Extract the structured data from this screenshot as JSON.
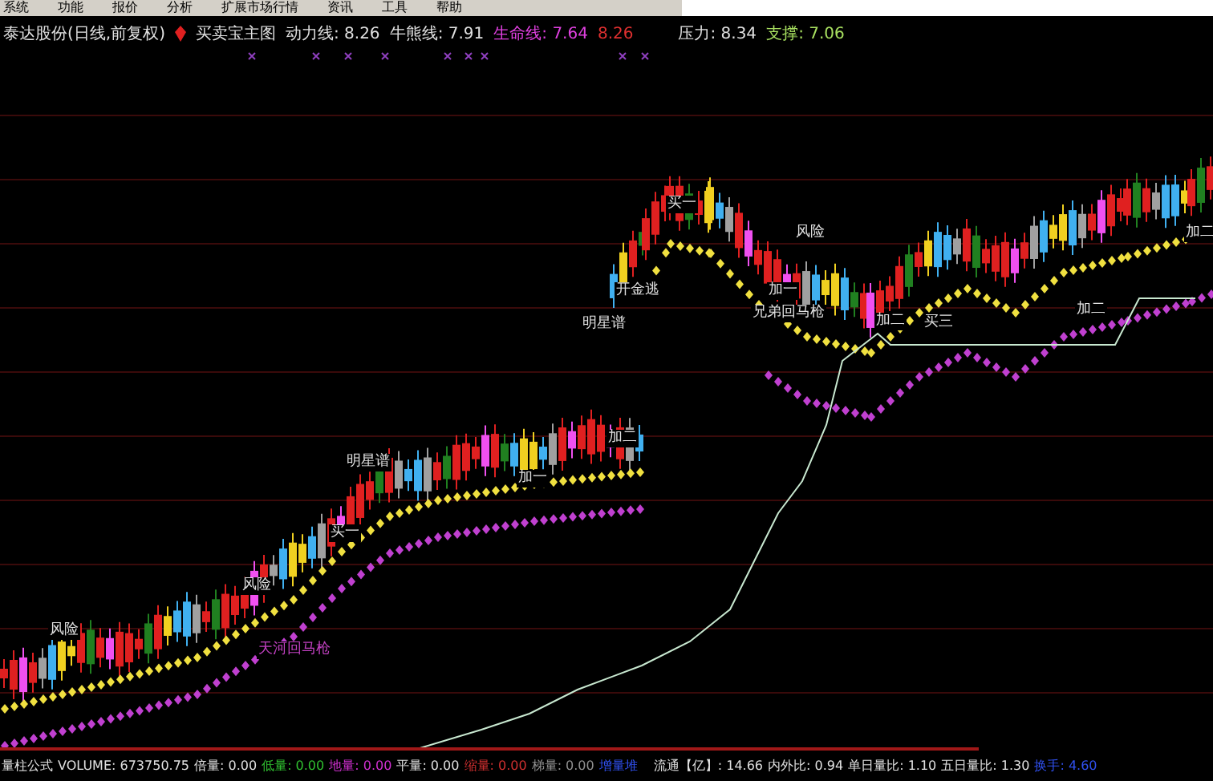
{
  "menu": [
    "系统",
    "功能",
    "报价",
    "分析",
    "扩展市场行情",
    "资讯",
    "工具",
    "帮助"
  ],
  "legend": {
    "title": "泰达股份(日线,前复权)",
    "indicator": "买卖宝主图",
    "items": [
      {
        "text": "动力线: 8.26",
        "color": "#e0e0e0"
      },
      {
        "text": "牛熊线: 7.91",
        "color": "#e0e0e0"
      },
      {
        "text": "生命线: 7.64",
        "color": "#e040e0"
      },
      {
        "text": "8.26",
        "color": "#e03030"
      },
      {
        "text": "压力: 8.34",
        "color": "#e0e0e0"
      },
      {
        "text": "支撑: 7.06",
        "color": "#a8e060"
      }
    ]
  },
  "chart_labels": [
    {
      "text": "风险",
      "kind": "signal"
    },
    {
      "text": "风险",
      "kind": "signal"
    },
    {
      "text": "风险",
      "kind": "signal"
    },
    {
      "text": "加二",
      "kind": "signal"
    },
    {
      "text": "加二",
      "kind": "signal"
    },
    {
      "text": "加二",
      "kind": "signal"
    },
    {
      "text": "加二",
      "kind": "signal"
    },
    {
      "text": "加一",
      "kind": "signal"
    },
    {
      "text": "加一",
      "kind": "signal"
    },
    {
      "text": "买一",
      "kind": "signal"
    },
    {
      "text": "买一",
      "kind": "signal"
    },
    {
      "text": "买三",
      "kind": "signal"
    },
    {
      "text": "天河回马枪",
      "kind": "pattern"
    },
    {
      "text": "兄弟回马枪",
      "kind": "signal"
    },
    {
      "text": "开金逃",
      "kind": "signal"
    },
    {
      "text": "明星谱",
      "kind": "signal"
    },
    {
      "text": "明星谱",
      "kind": "signal"
    }
  ],
  "status_left": [
    {
      "text": "量柱公式",
      "color": "#e0e0e0"
    },
    {
      "text": "VOLUME: 673750.75",
      "color": "#e0e0e0"
    },
    {
      "text": "倍量: 0.00",
      "color": "#e0e0e0"
    },
    {
      "text": "低量: 0.00",
      "color": "#30c030"
    },
    {
      "text": "地量: 0.00",
      "color": "#d030d0"
    },
    {
      "text": "平量: 0.00",
      "color": "#e0e0e0"
    },
    {
      "text": "缩量: 0.00",
      "color": "#d03030"
    },
    {
      "text": "梯量: 0.00",
      "color": "#909090"
    },
    {
      "text": "增量堆",
      "color": "#3050f0"
    }
  ],
  "status_right": [
    {
      "text": "流通【亿】: 14.66",
      "color": "#e0e0e0"
    },
    {
      "text": "内外比: 0.94",
      "color": "#e0e0e0"
    },
    {
      "text": "单日量比: 1.10",
      "color": "#e0e0e0"
    },
    {
      "text": "五日量比: 1.30",
      "color": "#e0e0e0"
    },
    {
      "text": "换手: 4.60",
      "color": "#3050f0"
    }
  ]
}
